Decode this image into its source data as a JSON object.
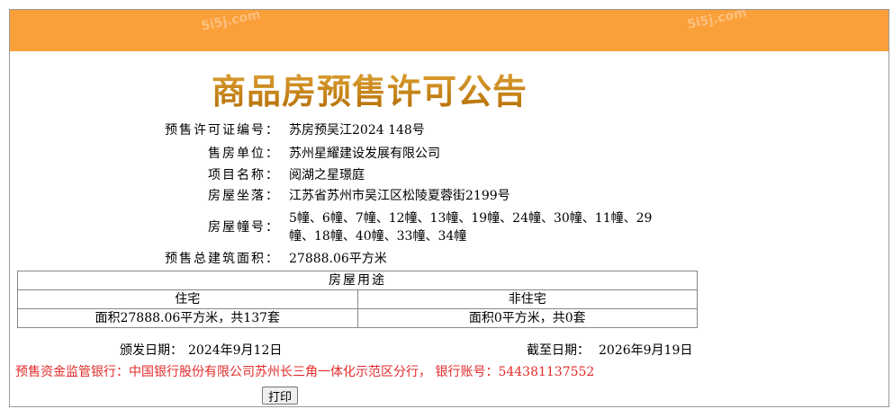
{
  "header": {
    "watermark_1": "5i5j.com",
    "watermark_2": "5i5j.com"
  },
  "title": "商品房预售许可公告",
  "fields": [
    {
      "label": "预售许可证编号：",
      "value": "苏房预吴江2024 148号"
    },
    {
      "label": "售房单位：",
      "value": "苏州星耀建设发展有限公司"
    },
    {
      "label": "项目名称：",
      "value": "阅湖之星璟庭"
    },
    {
      "label": "房屋坐落：",
      "value": "江苏省苏州市吴江区松陵夏蓉街2199号"
    },
    {
      "label": "房屋幢号：",
      "value_line1": "5幢、6幢、7幢、12幢、13幢、19幢、24幢、30幢、11幢、29",
      "value_line2": "幢、18幢、40幢、33幢、34幢"
    },
    {
      "label": "预售总建筑面积：",
      "value": "27888.06平方米"
    }
  ],
  "usage_table": {
    "header": "房屋用途",
    "col_residential": "住宅",
    "col_nonresidential": "非住宅",
    "residential_value": "面积27888.06平方米，共137套",
    "nonresidential_value": "面积0平方米，共0套"
  },
  "dates": {
    "issue_label": "颁发日期：",
    "issue_value": "2024年9月12日",
    "expire_label": "截至日期：",
    "expire_value": "2026年9月19日"
  },
  "bank": "预售资金监管银行：中国银行股份有限公司苏州长三角一体化示范区分行， 银行账号：544381137552",
  "print_button": "打印"
}
